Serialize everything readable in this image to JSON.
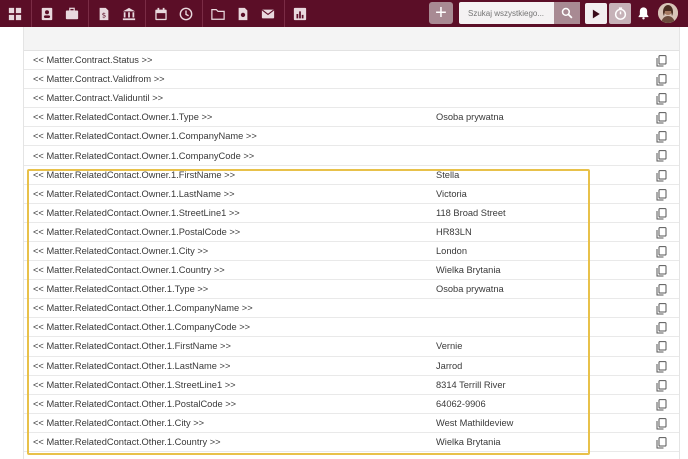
{
  "search": {
    "placeholder": "Szukaj wszystkiego..."
  },
  "nav_icons": [
    "dashboard-icon",
    "contacts-icon",
    "briefcase-icon",
    "invoice-icon",
    "bank-icon",
    "calendar-icon",
    "history-icon",
    "folder-icon",
    "document-search-icon",
    "mail-icon",
    "chart-icon"
  ],
  "rows": [
    {
      "key": "<< Matter.Contract.Status >>",
      "value": ""
    },
    {
      "key": "<< Matter.Contract.Validfrom >>",
      "value": ""
    },
    {
      "key": "<< Matter.Contract.Validuntil >>",
      "value": ""
    },
    {
      "key": "<< Matter.RelatedContact.Owner.1.Type >>",
      "value": "Osoba prywatna"
    },
    {
      "key": "<< Matter.RelatedContact.Owner.1.CompanyName >>",
      "value": ""
    },
    {
      "key": "<< Matter.RelatedContact.Owner.1.CompanyCode >>",
      "value": ""
    },
    {
      "key": "<< Matter.RelatedContact.Owner.1.FirstName >>",
      "value": "Stella"
    },
    {
      "key": "<< Matter.RelatedContact.Owner.1.LastName >>",
      "value": "Victoria"
    },
    {
      "key": "<< Matter.RelatedContact.Owner.1.StreetLine1 >>",
      "value": "118 Broad Street"
    },
    {
      "key": "<< Matter.RelatedContact.Owner.1.PostalCode >>",
      "value": "HR83LN"
    },
    {
      "key": "<< Matter.RelatedContact.Owner.1.City >>",
      "value": "London"
    },
    {
      "key": "<< Matter.RelatedContact.Owner.1.Country >>",
      "value": "Wielka Brytania"
    },
    {
      "key": "<< Matter.RelatedContact.Other.1.Type >>",
      "value": "Osoba prywatna"
    },
    {
      "key": "<< Matter.RelatedContact.Other.1.CompanyName >>",
      "value": ""
    },
    {
      "key": "<< Matter.RelatedContact.Other.1.CompanyCode >>",
      "value": ""
    },
    {
      "key": "<< Matter.RelatedContact.Other.1.FirstName >>",
      "value": "Vernie"
    },
    {
      "key": "<< Matter.RelatedContact.Other.1.LastName >>",
      "value": "Jarrod"
    },
    {
      "key": "<< Matter.RelatedContact.Other.1.StreetLine1 >>",
      "value": "8314 Terrill River"
    },
    {
      "key": "<< Matter.RelatedContact.Other.1.PostalCode >>",
      "value": "64062-9906"
    },
    {
      "key": "<< Matter.RelatedContact.Other.1.City >>",
      "value": "West Mathildeview"
    },
    {
      "key": "<< Matter.RelatedContact.Other.1.Country >>",
      "value": "Wielka Brytania"
    }
  ],
  "colors": {
    "topbar": "#5b0e27",
    "highlight": "#e8c14a"
  }
}
